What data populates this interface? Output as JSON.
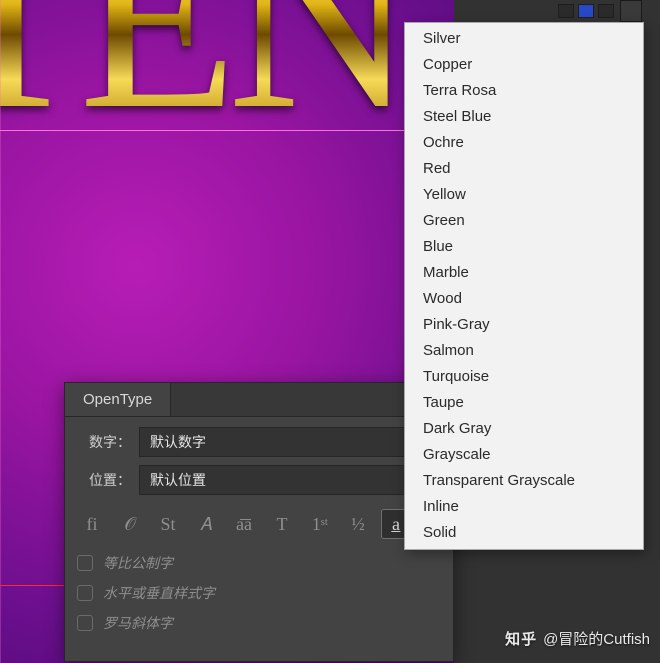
{
  "canvas": {
    "sample_text": "TEN"
  },
  "panel": {
    "tab_label": "OpenType",
    "rows": {
      "figure_label": "数字：",
      "figure_value": "默认数字",
      "position_label": "位置：",
      "position_value": "默认位置"
    },
    "icons": [
      {
        "name": "ligatures-icon",
        "glyph": "fi"
      },
      {
        "name": "swash-icon",
        "glyph": "𝒪"
      },
      {
        "name": "stylistic-icon",
        "glyph": "St"
      },
      {
        "name": "titling-icon",
        "glyph": "𝐴"
      },
      {
        "name": "contextual-icon",
        "glyph": "a͞a"
      },
      {
        "name": "smallcaps-icon",
        "glyph": "T"
      },
      {
        "name": "ordinals-icon",
        "glyph": "1ˢᵗ"
      },
      {
        "name": "fractions-icon",
        "glyph": "½"
      },
      {
        "name": "stylistic-sets-icon",
        "glyph": "a̲",
        "active": true
      }
    ],
    "checks": [
      "等比公制字",
      "水平或垂直样式字",
      "罗马斜体字"
    ]
  },
  "dropdown": {
    "items": [
      "Silver",
      "Copper",
      "Terra Rosa",
      "Steel Blue",
      "Ochre",
      "Red",
      "Yellow",
      "Green",
      "Blue",
      "Marble",
      "Wood",
      "Pink-Gray",
      "Salmon",
      "Turquoise",
      "Taupe",
      "Dark Gray",
      "Grayscale",
      "Transparent Grayscale",
      "Inline",
      "Solid"
    ]
  },
  "watermark": {
    "logo": "知乎",
    "text": "@冒险的Cutfish"
  }
}
